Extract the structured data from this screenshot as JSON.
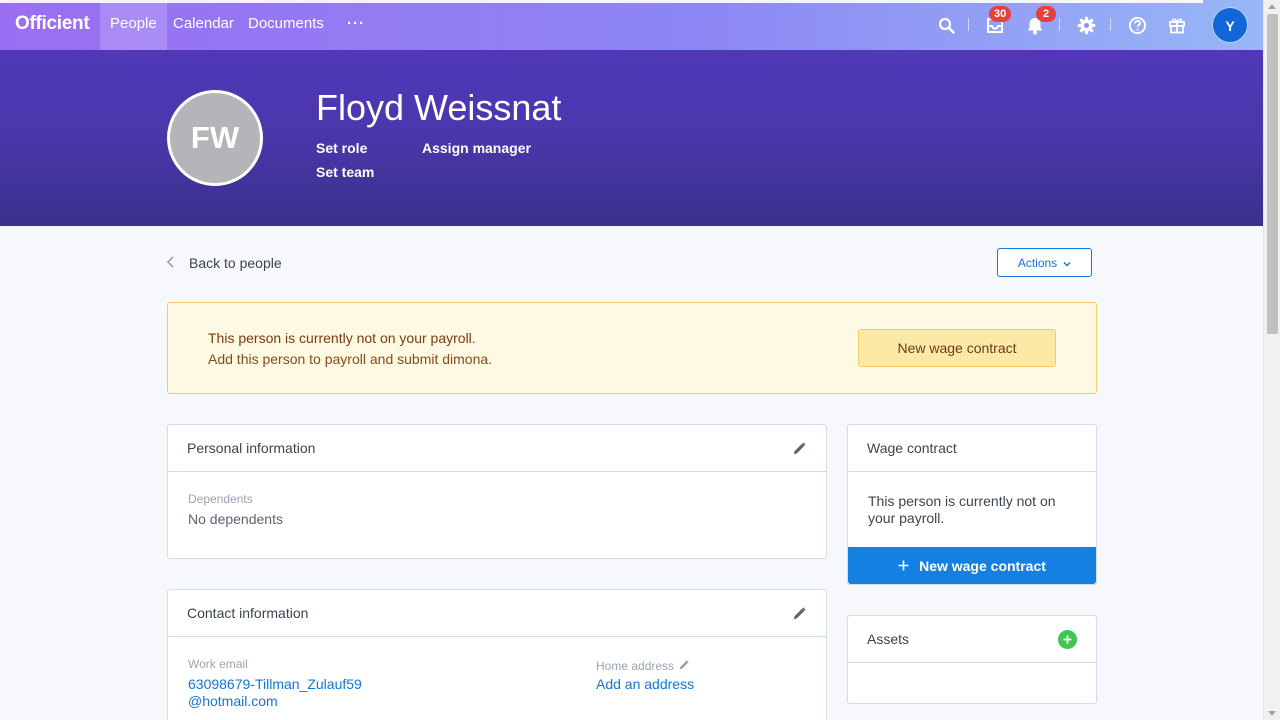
{
  "app": {
    "brand": "Officient"
  },
  "nav": {
    "links": [
      {
        "label": "People",
        "active": true
      },
      {
        "label": "Calendar",
        "active": false
      },
      {
        "label": "Documents",
        "active": false
      }
    ],
    "more_label": "···",
    "inbox_badge": "30",
    "notifications_badge": "2",
    "user_initial": "Y",
    "icons": [
      "search-icon",
      "inbox-icon",
      "bell-icon",
      "gear-icon",
      "help-icon",
      "gift-icon"
    ]
  },
  "profile": {
    "initials": "FW",
    "name": "Floyd Weissnat",
    "set_role": "Set role",
    "assign_manager": "Assign manager",
    "set_team": "Set team"
  },
  "page": {
    "back_label": "Back to people",
    "actions_label": "Actions"
  },
  "payroll_banner": {
    "title": "This person is currently not on your payroll.",
    "subtitle": "Add this person to payroll and submit dimona.",
    "button": "New wage contract"
  },
  "personal_info": {
    "title": "Personal information",
    "dependents_label": "Dependents",
    "dependents_value": "No dependents"
  },
  "contact_info": {
    "title": "Contact information",
    "work_email_label": "Work email",
    "work_email_line1": "63098679-Tillman_Zulauf59",
    "work_email_line2": "@hotmail.com",
    "home_address_label": "Home address",
    "home_address_link": "Add an address"
  },
  "wage_contract": {
    "title": "Wage contract",
    "text_line1": "This person is currently not on",
    "text_line2": "your payroll.",
    "button": "New wage contract"
  },
  "assets": {
    "title": "Assets"
  },
  "colors": {
    "primary": "#1380e2",
    "hero": "#4c37ad",
    "badge": "#e8413d",
    "add": "#3ec84e"
  }
}
